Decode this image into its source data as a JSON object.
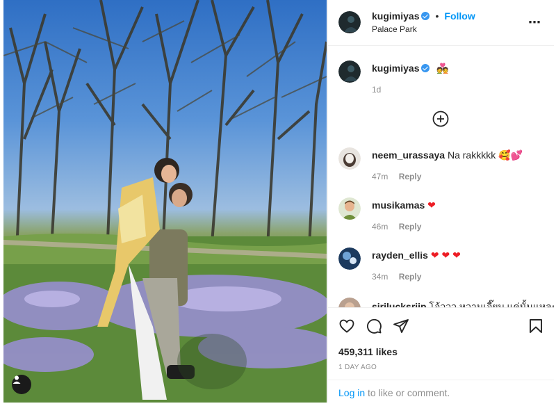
{
  "post": {
    "author": "kugimiyas",
    "follow_label": "Follow",
    "separator": "•",
    "location": "Palace Park",
    "more_icon": "more-horizontal-icon",
    "caption_emoji": "💑",
    "caption_time": "1d",
    "likes": "459,311 likes",
    "date": "1 DAY AGO"
  },
  "comments": [
    {
      "user": "neem_urassaya",
      "text": "Na rakkkkk",
      "emoji": "🥰💕",
      "time": "47m",
      "reply": "Reply"
    },
    {
      "user": "musikamas",
      "text": "",
      "emoji": "❤",
      "time": "46m",
      "reply": "Reply"
    },
    {
      "user": "rayden_ellis",
      "text": "",
      "emoji": "❤ ❤ ❤",
      "time": "34m",
      "reply": "Reply"
    },
    {
      "user": "sirilucksrijp",
      "text": "โอ้ววว หวานเจี๊ยบ แค่นั้นแหละค่ะ",
      "emoji": "",
      "time": "",
      "reply": ""
    }
  ],
  "footer": {
    "login_link": "Log in",
    "login_rest": " to like or comment."
  },
  "colors": {
    "accent": "#0095f6",
    "verified": "#3897f0",
    "heart": "#ed1c24"
  }
}
